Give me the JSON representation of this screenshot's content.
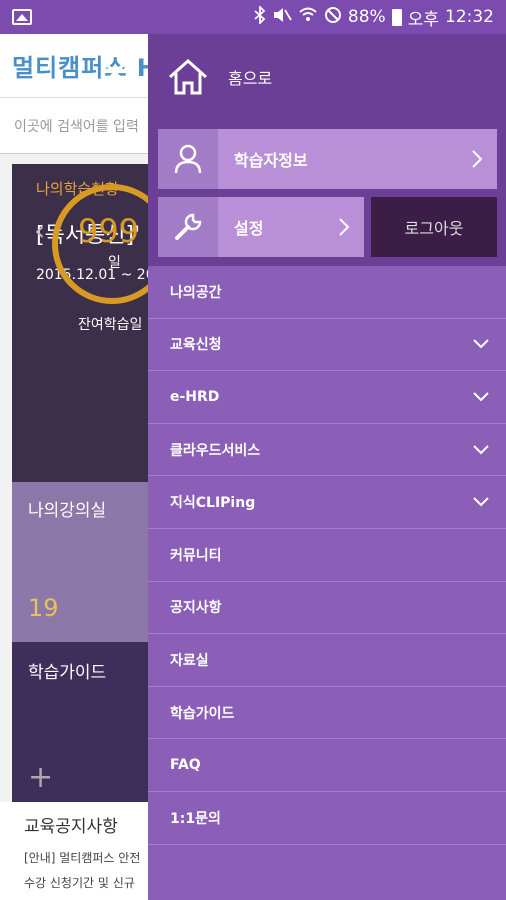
{
  "status_bar": {
    "battery": "88%",
    "ampm": "오후",
    "time": "12:32"
  },
  "background": {
    "logo": "멀티캠퍼스 H",
    "search_placeholder": "이곳에 검색어를 입력",
    "panel_learning_status": "나의학습현황",
    "course_title": "[독서통신]'",
    "course_date": "2015.12.01 ~ 20",
    "remaining_days": "999",
    "days_unit": "일",
    "remaining_label": "잔여학습일",
    "my_classroom": "나의강의실",
    "classroom_count": "19",
    "learning_guide": "학습가이드",
    "notice_title": "교육공지사항",
    "notice_lines": [
      "[안내] 멀티캠퍼스 안전",
      "수강 신청기간 및 신규"
    ]
  },
  "drawer": {
    "home_label": "홈으로",
    "profile_label": "학습자정보",
    "settings_label": "설정",
    "logout_label": "로그아웃",
    "menu": [
      {
        "label": "나의공간",
        "expandable": false
      },
      {
        "label": "교육신청",
        "expandable": true
      },
      {
        "label": "e-HRD",
        "expandable": true
      },
      {
        "label": "클라우드서비스",
        "expandable": true
      },
      {
        "label": "지식CLIPing",
        "expandable": true
      },
      {
        "label": "커뮤니티",
        "expandable": false
      },
      {
        "label": "공지사항",
        "expandable": false
      },
      {
        "label": "자료실",
        "expandable": false
      },
      {
        "label": "학습가이드",
        "expandable": false
      },
      {
        "label": "FAQ",
        "expandable": false
      },
      {
        "label": "1:1문의",
        "expandable": false
      }
    ]
  },
  "colors": {
    "drawer_bg": "#8b5fb8",
    "drawer_header": "#6b3f96",
    "button_bg": "#b98fd8",
    "logout_bg": "#3b1d46"
  }
}
